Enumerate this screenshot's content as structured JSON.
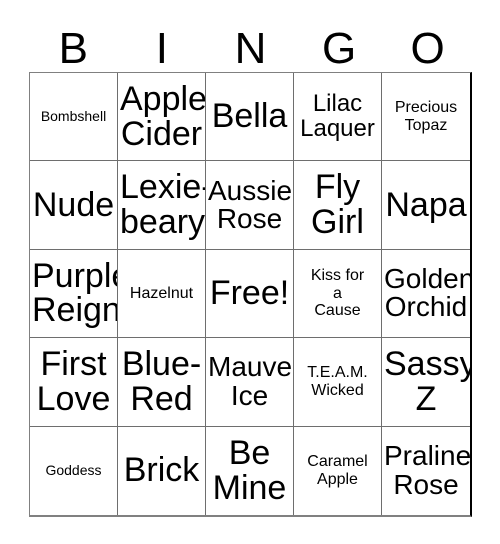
{
  "header": {
    "letters": [
      "B",
      "I",
      "N",
      "G",
      "O"
    ]
  },
  "grid": {
    "columns": 5,
    "rows": 5,
    "cells": [
      {
        "label": "Bombshell",
        "size": "xs"
      },
      {
        "label": "Apple\nCider",
        "size": "xxl"
      },
      {
        "label": "Bella",
        "size": "xxl"
      },
      {
        "label": "Lilac\nLaquer",
        "size": "lg"
      },
      {
        "label": "Precious\nTopaz",
        "size": "sm"
      },
      {
        "label": "Nude",
        "size": "xxl"
      },
      {
        "label": "Lexie-\nbeary",
        "size": "xxl"
      },
      {
        "label": "Aussie\nRose",
        "size": "xl"
      },
      {
        "label": "Fly\nGirl",
        "size": "xxl"
      },
      {
        "label": "Napa",
        "size": "xxl"
      },
      {
        "label": "Purple\nReign",
        "size": "xxl"
      },
      {
        "label": "Hazelnut",
        "size": "sm"
      },
      {
        "label": "Free!",
        "size": "xxl"
      },
      {
        "label": "Kiss for\na\nCause",
        "size": "sm"
      },
      {
        "label": "Golden\nOrchid",
        "size": "xl"
      },
      {
        "label": "First\nLove",
        "size": "xxl"
      },
      {
        "label": "Blue-\nRed",
        "size": "xxl"
      },
      {
        "label": "Mauve\nIce",
        "size": "xl"
      },
      {
        "label": "T.E.A.M.\nWicked",
        "size": "sm"
      },
      {
        "label": "Sassy\nZ",
        "size": "xxl"
      },
      {
        "label": "Goddess",
        "size": "xs"
      },
      {
        "label": "Brick",
        "size": "xxl"
      },
      {
        "label": "Be\nMine",
        "size": "xxl"
      },
      {
        "label": "Caramel\nApple",
        "size": "sm"
      },
      {
        "label": "Praline\nRose",
        "size": "xl"
      }
    ]
  }
}
